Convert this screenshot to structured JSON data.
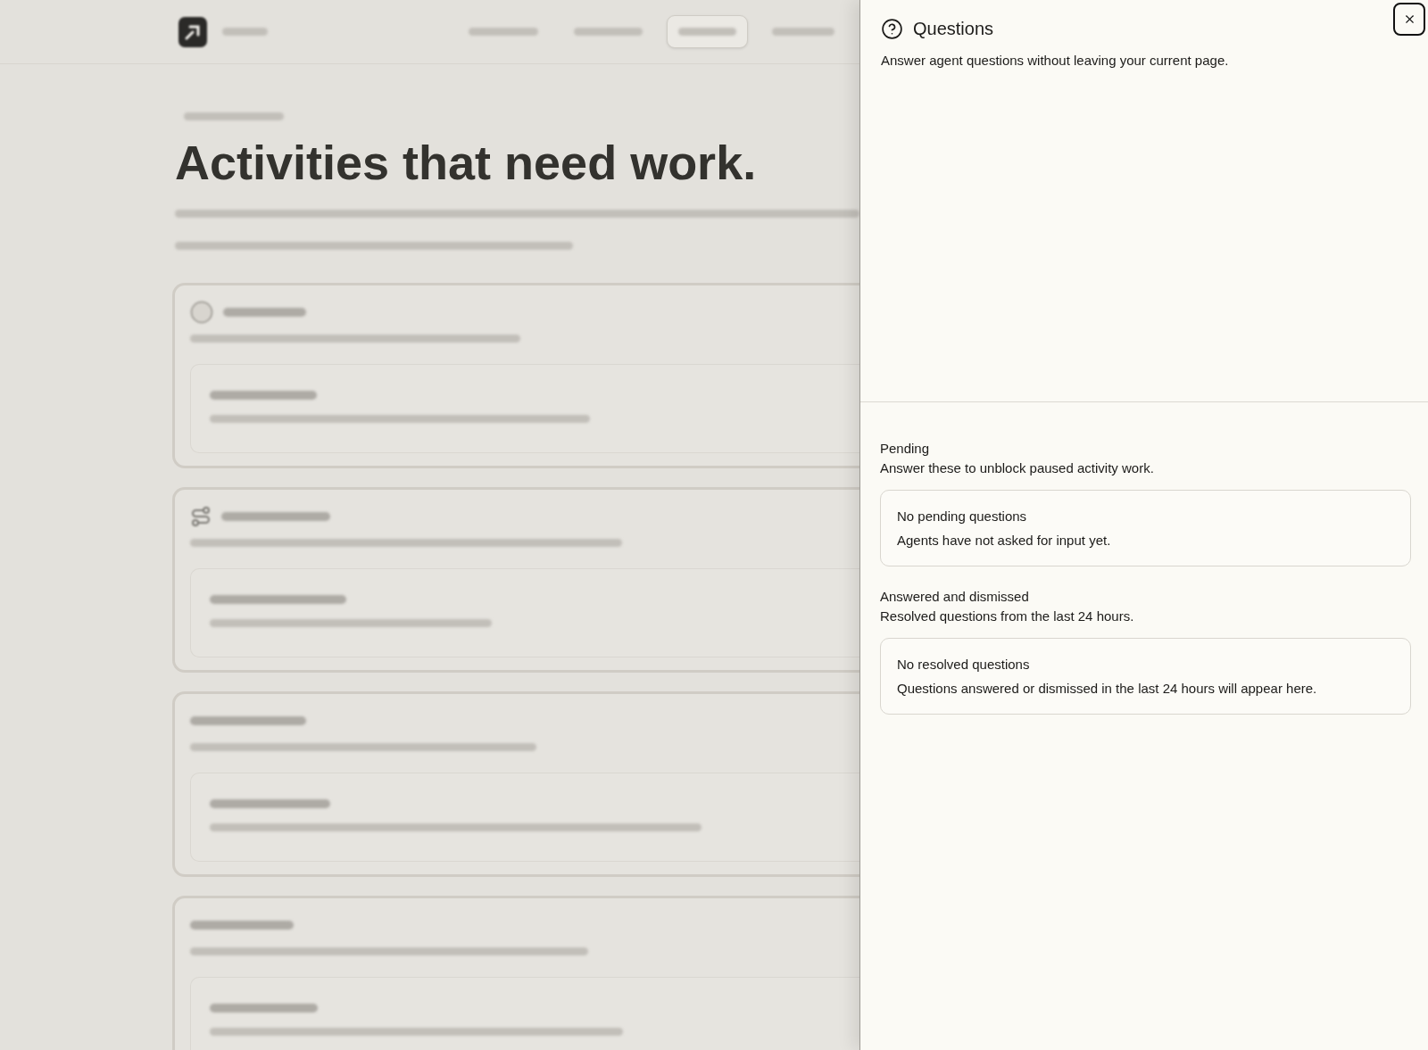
{
  "background_page": {
    "nav": {
      "items": [
        {
          "selected": false
        },
        {
          "selected": false
        },
        {
          "selected": true
        },
        {
          "selected": false
        }
      ]
    },
    "title": "Activities that need work."
  },
  "drawer": {
    "title": "Questions",
    "subtitle": "Answer agent questions without leaving your current page.",
    "groups": [
      {
        "title": "Pending",
        "description": "Answer these to unblock paused activity work.",
        "empty_title": "No pending questions",
        "empty_text": "Agents have not asked for input yet."
      },
      {
        "title": "Answered and dismissed",
        "description": "Resolved questions from the last 24 hours.",
        "empty_title": "No resolved questions",
        "empty_text": "Questions answered or dismissed in the last 24 hours will appear here."
      }
    ]
  }
}
